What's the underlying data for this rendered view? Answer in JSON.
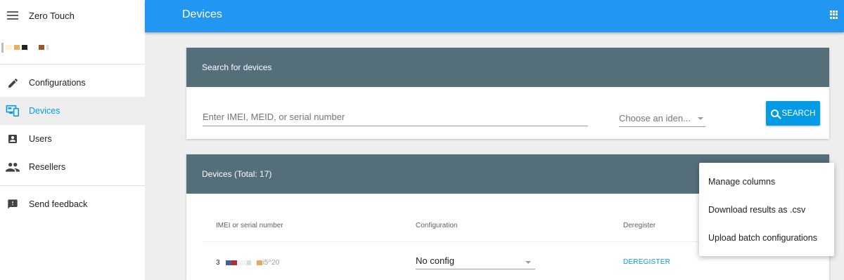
{
  "sidebar": {
    "app_title": "Zero Touch",
    "account_swatch_colors": [
      "#bdbdbd",
      "#fff4cc",
      "#e8b060",
      "#222222",
      "#ffffff",
      "#a0522d",
      "#dddddd"
    ],
    "nav_items": [
      {
        "label": "Configurations",
        "icon": "pencil-icon"
      },
      {
        "label": "Devices",
        "icon": "devices-icon",
        "active": true
      },
      {
        "label": "Users",
        "icon": "account-box-icon"
      },
      {
        "label": "Resellers",
        "icon": "people-icon"
      }
    ],
    "feedback_label": "Send feedback"
  },
  "topbar": {
    "title": "Devices",
    "apps_icon": "apps-grid-icon"
  },
  "search_card": {
    "header": "Search for devices",
    "input_placeholder": "Enter IMEI, MEID, or serial number",
    "identifier_select": "Choose an iden...",
    "button_label": "SEARCH"
  },
  "devices_card": {
    "header": "Devices (Total: 17)",
    "columns": [
      "IMEI or serial number",
      "Configuration",
      "Deregister"
    ],
    "rows": [
      {
        "id_prefix": "3",
        "id_suffix": "i5^20",
        "configuration": "No config",
        "deregister": "DEREGISTER"
      }
    ]
  },
  "overflow_menu": {
    "items": [
      "Manage columns",
      "Download results as .csv",
      "Upload batch configurations"
    ]
  },
  "colors": {
    "primary": "#2196f3",
    "card_header": "#546e7a",
    "accent": "#039be5"
  }
}
